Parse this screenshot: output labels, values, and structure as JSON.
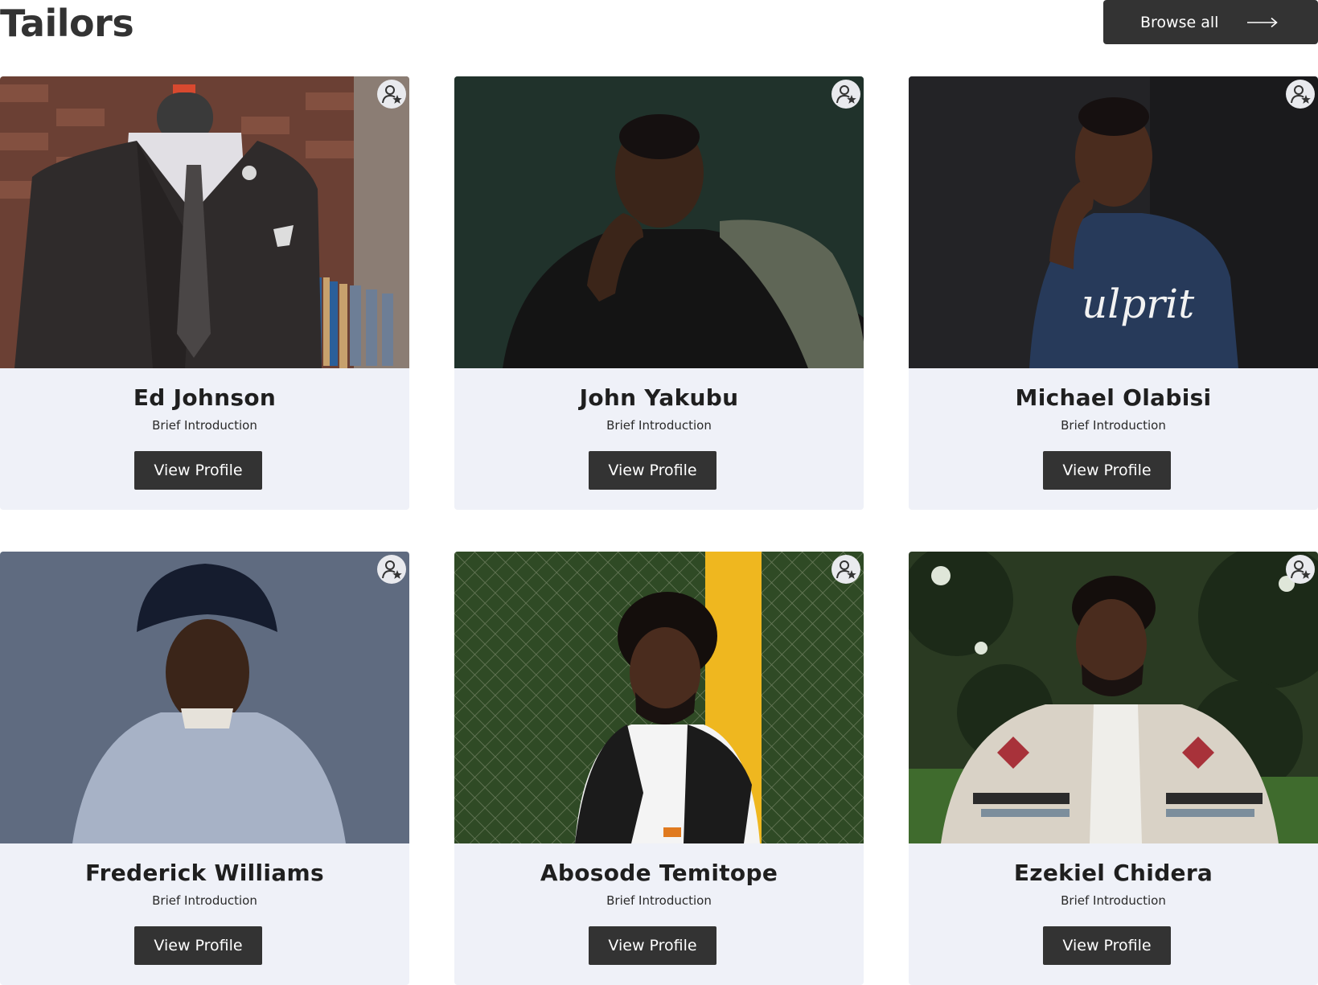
{
  "page": {
    "title": "Tailors",
    "browse_label": "Browse all"
  },
  "cards": [
    {
      "name": "Ed Johnson",
      "intro": "Brief Introduction",
      "button": "View Profile",
      "photo": "mannequin-suit-photo",
      "fav_icon": "user-star-icon"
    },
    {
      "name": "John Yakubu",
      "intro": "Brief Introduction",
      "button": "View Profile",
      "photo": "portrait-dark-green-photo",
      "fav_icon": "user-star-icon"
    },
    {
      "name": "Michael Olabisi",
      "intro": "Brief Introduction",
      "button": "View Profile",
      "photo": "portrait-navy-tshirt-photo",
      "fav_icon": "user-star-icon"
    },
    {
      "name": "Frederick Williams",
      "intro": "Brief Introduction",
      "button": "View Profile",
      "photo": "portrait-bucket-hat-photo",
      "fav_icon": "user-star-icon"
    },
    {
      "name": "Abosode Temitope",
      "intro": "Brief Introduction",
      "button": "View Profile",
      "photo": "portrait-fence-photo",
      "fav_icon": "user-star-icon"
    },
    {
      "name": "Ezekiel Chidera",
      "intro": "Brief Introduction",
      "button": "View Profile",
      "photo": "portrait-patterned-jacket-photo",
      "fav_icon": "user-star-icon"
    }
  ],
  "colors": {
    "button_bg": "#333333",
    "card_bg": "#eff1f8",
    "text": "#1f1f1f"
  },
  "icons": {
    "browse_arrow": "arrow-right-icon",
    "favorite": "user-star-icon"
  }
}
